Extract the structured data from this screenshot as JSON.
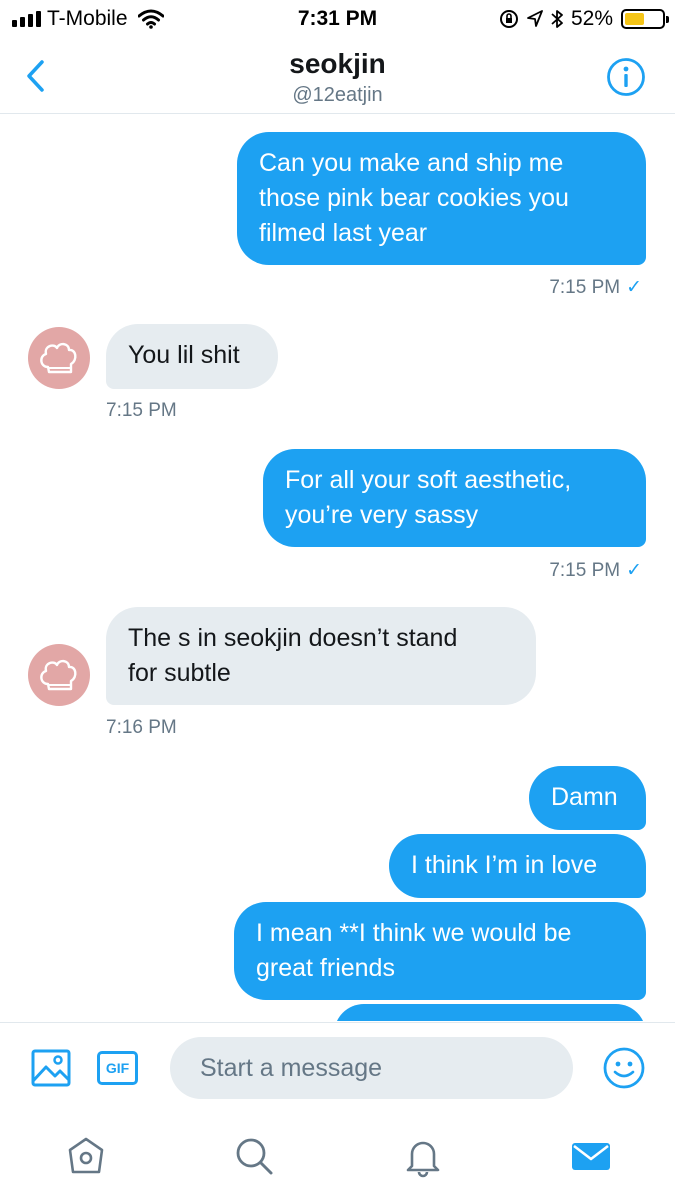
{
  "status_bar": {
    "carrier": "T-Mobile",
    "time": "7:31 PM",
    "battery": "52%",
    "battery_level": 0.52
  },
  "header": {
    "title": "seokjin",
    "handle": "@12eatjin"
  },
  "messages": [
    {
      "direction": "out",
      "lines": [
        "Can you make and ship me",
        "those pink bear cookies you",
        "filmed last year"
      ],
      "time": "7:15 PM ✓"
    },
    {
      "direction": "in",
      "lines": [
        "You lil shit"
      ],
      "time": "7:15 PM"
    },
    {
      "direction": "out",
      "lines": [
        "For all your soft aesthetic,",
        "you’re very sassy"
      ],
      "time": "7:15 PM ✓"
    },
    {
      "direction": "in",
      "lines": [
        "The s in seokjin doesn’t stand",
        "for subtle"
      ],
      "time": "7:16 PM"
    },
    {
      "direction": "out",
      "lines": [
        "Damn"
      ]
    },
    {
      "direction": "out",
      "lines": [
        "I think I’m in love"
      ]
    },
    {
      "direction": "out",
      "lines": [
        "I mean **I think we would be",
        "great friends"
      ]
    }
  ],
  "composer": {
    "gif_label": "GIF",
    "placeholder": "Start a message"
  },
  "colors": {
    "accent": "#1da1f2",
    "incoming_bubble": "#e6ecf0",
    "avatar": "#e2a7a6",
    "battery": "#f5c518"
  },
  "icons": [
    "back-chevron-icon",
    "info-icon",
    "image-icon",
    "emoji-icon",
    "home-icon",
    "search-icon",
    "bell-icon",
    "mail-icon"
  ]
}
